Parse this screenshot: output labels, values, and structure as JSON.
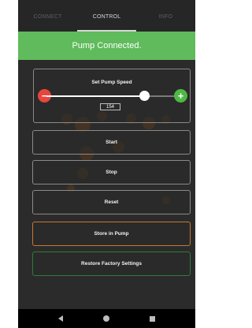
{
  "tabs": [
    {
      "label": "CONNECT",
      "active": false
    },
    {
      "label": "CONTROL",
      "active": true
    },
    {
      "label": "INFO",
      "active": false
    }
  ],
  "status_banner": {
    "text": "Pump Connected.",
    "color": "#5fbb5b"
  },
  "speed_control": {
    "title": "Set Pump Speed",
    "value": "154",
    "slider_fraction": 0.74,
    "decrease_icon": "minus-icon",
    "increase_icon": "plus-icon"
  },
  "buttons": {
    "start": "Start",
    "stop": "Stop",
    "reset": "Reset",
    "store": "Store in Pump",
    "restore": "Restore Factory Settings"
  },
  "colors": {
    "accent_green": "#4fb846",
    "accent_red": "#e7453d",
    "store_border": "#c6782c",
    "restore_border": "#2f7a3b"
  },
  "navbar": {
    "icons": [
      "back-icon",
      "home-icon",
      "recent-apps-icon"
    ]
  }
}
